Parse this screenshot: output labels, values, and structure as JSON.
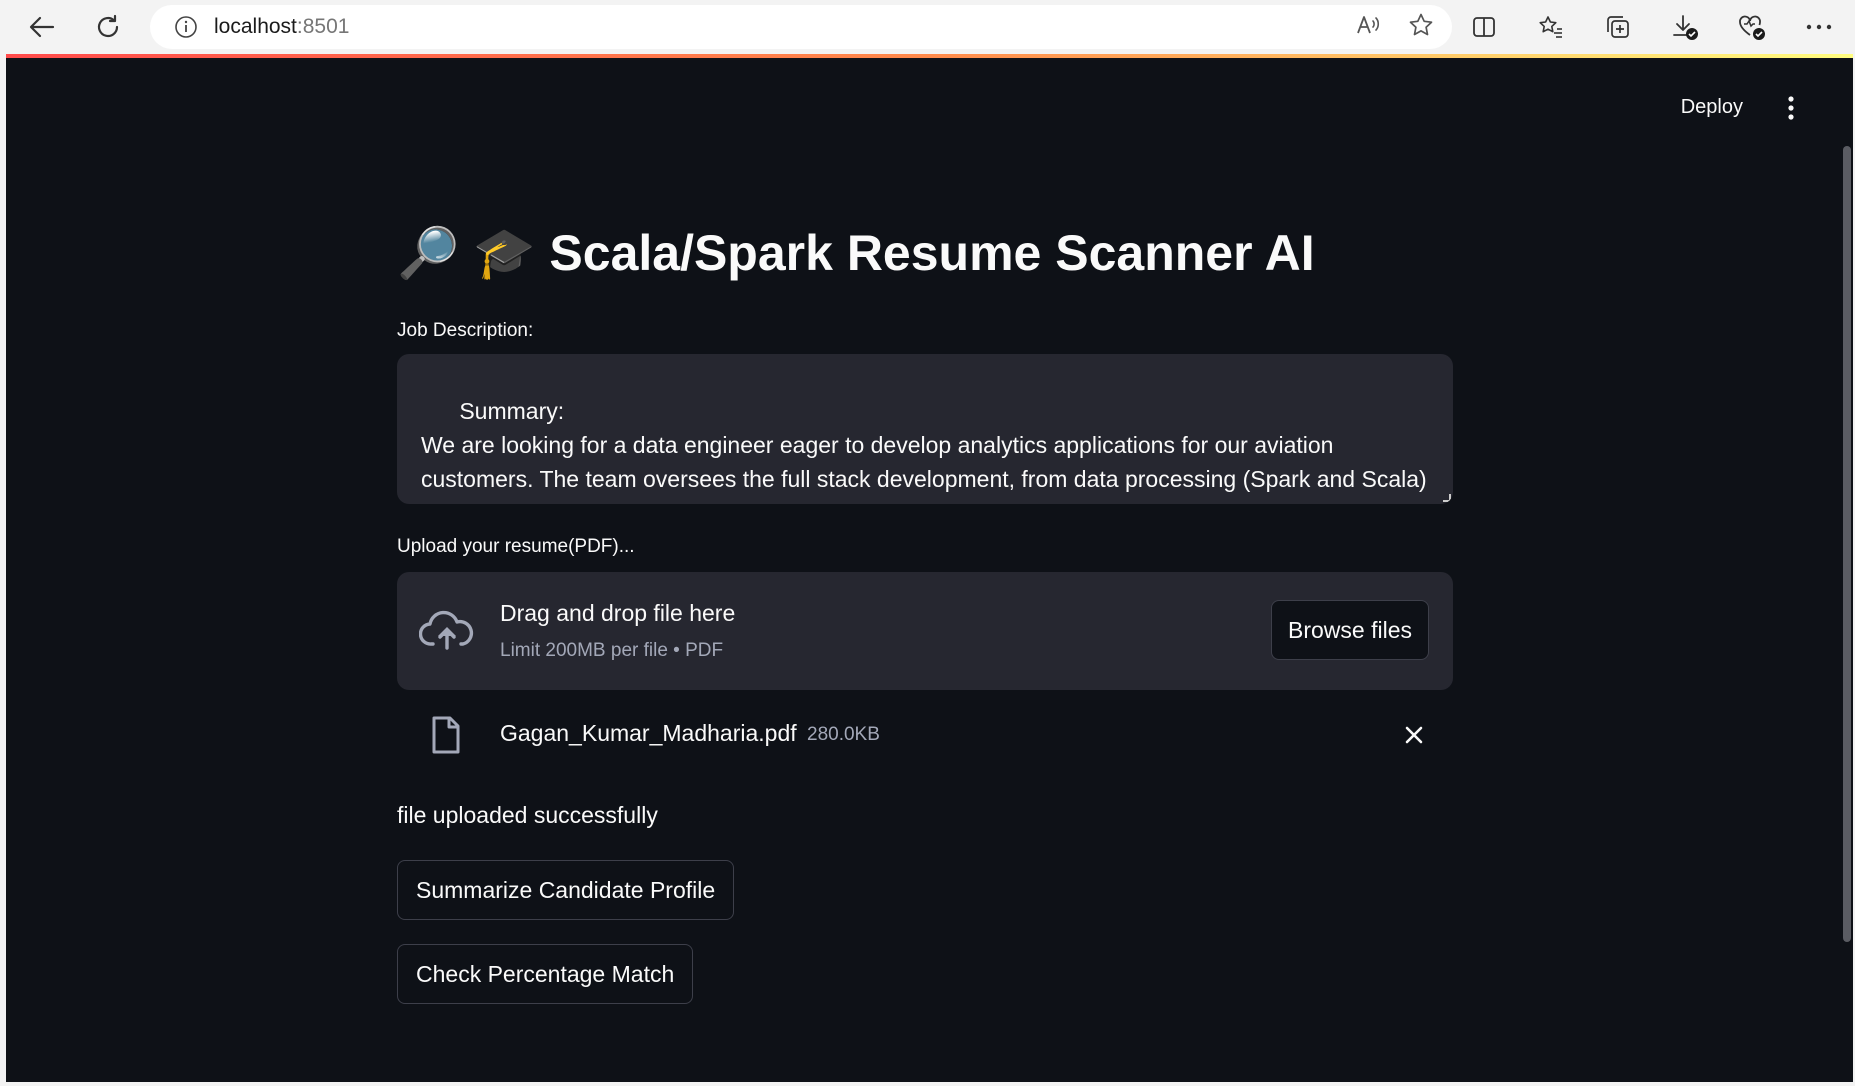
{
  "browser": {
    "url_host": "localhost",
    "url_port": ":8501"
  },
  "app": {
    "deploy_label": "Deploy",
    "title_emojis": "🔎 🎓",
    "title": "Scala/Spark Resume Scanner AI",
    "job_description": {
      "label": "Job Description:",
      "value": "Summary:\nWe are looking for a data engineer eager to develop analytics applications for our aviation customers. The team oversees the full stack development, from data processing (Spark and Scala) up to Data visualization, Azur provisioning and orchestration with native azure services."
    },
    "uploader": {
      "label": "Upload your resume(PDF)...",
      "drop_title": "Drag and drop file here",
      "drop_limit": "Limit 200MB per file • PDF",
      "browse_label": "Browse files"
    },
    "uploaded_file": {
      "name": "Gagan_Kumar_Madharia.pdf",
      "size": "280.0KB"
    },
    "status_message": "file uploaded successfully",
    "buttons": {
      "summarize": "Summarize Candidate Profile",
      "percentage": "Check Percentage Match"
    }
  }
}
